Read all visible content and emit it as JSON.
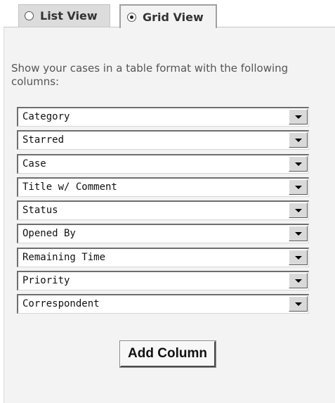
{
  "tabs": [
    {
      "label": "List View",
      "selected": false
    },
    {
      "label": "Grid View",
      "selected": true
    }
  ],
  "instructions": "Show your cases in a table format with the following columns:",
  "columns": [
    "Category",
    "Starred",
    "Case",
    "Title w/ Comment",
    "Status",
    "Opened By",
    "Remaining Time",
    "Priority",
    "Correspondent"
  ],
  "add_button_label": "Add Column",
  "icons": {
    "select_arrow": "chevron-down-icon",
    "radio": "radio-icon"
  }
}
